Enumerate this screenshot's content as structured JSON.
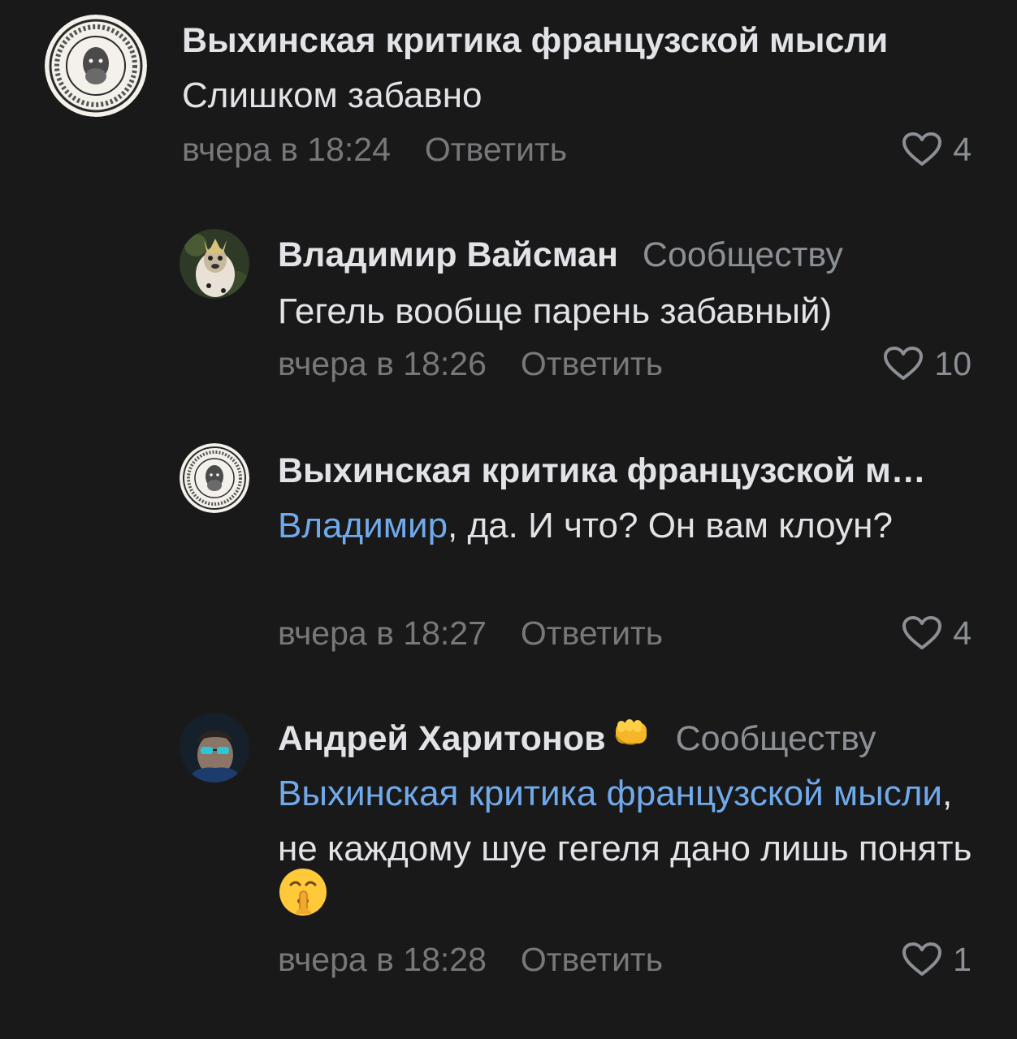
{
  "comments": [
    {
      "author": "Выхинская критика французской мысли",
      "community_label": "",
      "text": "Слишком забавно",
      "time": "вчера в 18:24",
      "reply_label": "Ответить",
      "likes": "4",
      "avatar": "seal-avatar"
    },
    {
      "author": "Владимир Вайсман",
      "community_label": "Сообществу",
      "text": "Гегель вообще парень забавный)",
      "time": "вчера в 18:26",
      "reply_label": "Ответить",
      "likes": "10",
      "avatar": "dog-avatar"
    },
    {
      "author": "Выхинская критика французской м…",
      "community_label": "",
      "mention": "Владимир",
      "text": ", да. И что? Он вам клоун?",
      "time": "вчера в 18:27",
      "reply_label": "Ответить",
      "likes": "4",
      "avatar": "seal-avatar"
    },
    {
      "author": "Андрей Харитонов",
      "author_badge": "fist-emoji",
      "community_label": "Сообществу",
      "mention": "Выхинская критика французской мысли",
      "text": ", не каждому шуе гегеля дано лишь понять",
      "text_emoji": "shushing-face-emoji",
      "time": "вчера в 18:28",
      "reply_label": "Ответить",
      "likes": "1",
      "avatar": "sunglasses-avatar"
    }
  ],
  "colors": {
    "background": "#19191a",
    "text": "#e1e3e6",
    "secondary": "#76787a",
    "link": "#71aaeb"
  }
}
